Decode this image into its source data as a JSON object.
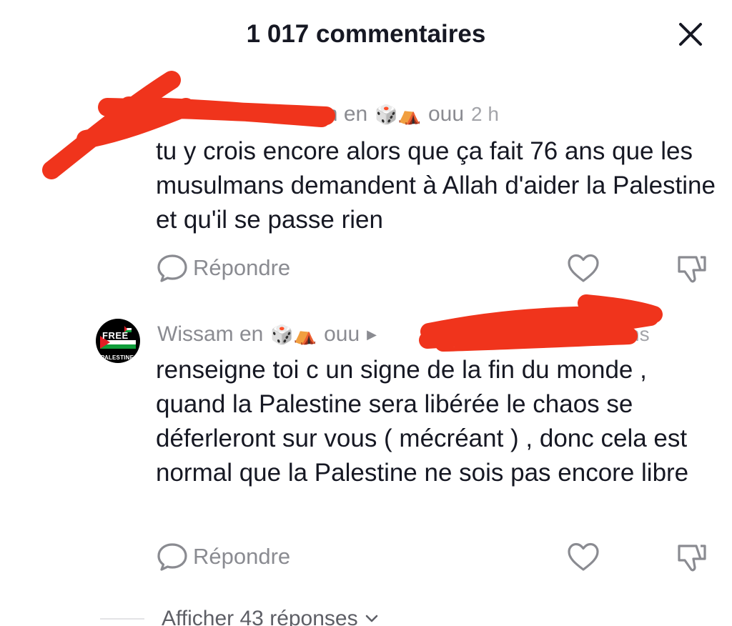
{
  "header": {
    "title": "1 017 commentaires"
  },
  "comments": [
    {
      "reply_to": "Wissam en",
      "reply_to_suffix": "ouu",
      "reply_to_emoji": "🎲⛺",
      "time": "2 h",
      "text": "tu y crois encore alors que ça fait 76 ans que les musulmans demandent à Allah d'aider la Palestine et qu'il se passe rien",
      "reply_label": "Répondre"
    },
    {
      "user": "Wissam en",
      "user_suffix": "ouu",
      "user_emoji": "🎲⛺",
      "time_partial": "ns",
      "avatar_text_top": "FREE",
      "avatar_text_bottom": "PALESTINE",
      "text": "renseigne toi c un signe de la fin du monde , quand la Palestine sera libérée le chaos se déferleront sur vous ( mécréant ) , donc cela est normal que la Palestine ne sois pas encore libre",
      "reply_label": "Répondre"
    }
  ],
  "show_replies": {
    "label": "Afficher 43 réponses"
  },
  "colors": {
    "redaction": "#f0341c",
    "muted_text": "#8a8b91",
    "primary_text": "#161823"
  },
  "icons": [
    "close-icon",
    "reply-bubble-icon",
    "heart-icon",
    "dislike-icon",
    "chevron-down-icon"
  ]
}
